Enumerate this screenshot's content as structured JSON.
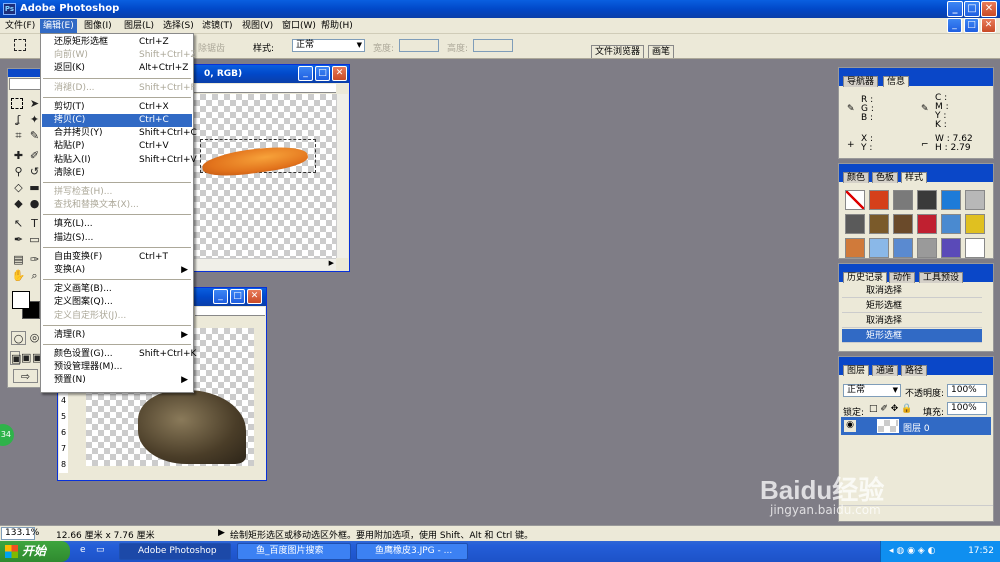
{
  "app": {
    "title": "Adobe Photoshop",
    "icon": "photoshop-icon"
  },
  "menubar": [
    "文件(F)",
    "编辑(E)",
    "图像(I)",
    "图层(L)",
    "选择(S)",
    "滤镜(T)",
    "视图(V)",
    "窗口(W)",
    "帮助(H)"
  ],
  "options": {
    "feather_label": "除锯齿",
    "style_label": "样式:",
    "style_value": "正常",
    "width_label": "宽度:",
    "height_label": "高度:",
    "tab_files": "文件浏览器",
    "tab_brushes": "画笔"
  },
  "doc1": {
    "title": "0, RGB)"
  },
  "edit_menu": [
    {
      "label": "还原矩形选框",
      "shortcut": "Ctrl+Z",
      "state": "normal"
    },
    {
      "label": "向前(W)",
      "shortcut": "Shift+Ctrl+Z",
      "state": "disabled"
    },
    {
      "label": "返回(K)",
      "shortcut": "Alt+Ctrl+Z",
      "state": "normal"
    },
    {
      "label": "消褪(D)...",
      "shortcut": "Shift+Ctrl+F",
      "state": "disabled"
    },
    {
      "label": "剪切(T)",
      "shortcut": "Ctrl+X",
      "state": "normal"
    },
    {
      "label": "拷贝(C)",
      "shortcut": "Ctrl+C",
      "state": "selected"
    },
    {
      "label": "合并拷贝(Y)",
      "shortcut": "Shift+Ctrl+C",
      "state": "normal"
    },
    {
      "label": "粘贴(P)",
      "shortcut": "Ctrl+V",
      "state": "normal"
    },
    {
      "label": "粘贴入(I)",
      "shortcut": "Shift+Ctrl+V",
      "state": "normal"
    },
    {
      "label": "清除(E)",
      "shortcut": "",
      "state": "normal"
    },
    {
      "label": "拼写检查(H)...",
      "shortcut": "",
      "state": "disabled"
    },
    {
      "label": "查找和替换文本(X)...",
      "shortcut": "",
      "state": "disabled"
    },
    {
      "label": "填充(L)...",
      "shortcut": "",
      "state": "normal"
    },
    {
      "label": "描边(S)...",
      "shortcut": "",
      "state": "normal"
    },
    {
      "label": "自由变换(F)",
      "shortcut": "Ctrl+T",
      "state": "normal"
    },
    {
      "label": "变换(A)",
      "shortcut": "",
      "state": "normal",
      "submenu": true
    },
    {
      "label": "定义画笔(B)...",
      "shortcut": "",
      "state": "normal"
    },
    {
      "label": "定义图案(Q)...",
      "shortcut": "",
      "state": "normal"
    },
    {
      "label": "定义自定形状(J)...",
      "shortcut": "",
      "state": "disabled"
    },
    {
      "label": "清理(R)",
      "shortcut": "",
      "state": "normal",
      "submenu": true
    },
    {
      "label": "颜色设置(G)...",
      "shortcut": "Shift+Ctrl+K",
      "state": "normal"
    },
    {
      "label": "预设管理器(M)...",
      "shortcut": "",
      "state": "normal"
    },
    {
      "label": "预置(N)",
      "shortcut": "",
      "state": "normal",
      "submenu": true
    }
  ],
  "navigator": {
    "tab1": "导航器",
    "tab2": "信息",
    "r": "R :",
    "g": "G :",
    "b": "B :",
    "c": "C :",
    "m": "M :",
    "y": "Y :",
    "k": "K :",
    "x": "X :",
    "yy": "Y :",
    "w": "W :",
    "w_val": "7.62",
    "h": "H :",
    "h_val": "2.79"
  },
  "swatches": {
    "tab1": "颜色",
    "tab2": "色板",
    "tab3": "样式",
    "colors": [
      "#ffffff",
      "#d5401a",
      "#7a7a7a",
      "#3a3a3a",
      "#1d7bd8",
      "#b8b8b8",
      "#5a5a5a",
      "#7a5a2a",
      "#6a4a2a",
      "#c02030",
      "#4a8ad0",
      "#e0c020",
      "#d07a3a",
      "#8ab8e8",
      "#5a8ad0",
      "#9a9a9a",
      "#5a4ab8",
      "#ffffff"
    ]
  },
  "history": {
    "tab1": "历史记录",
    "tab2": "动作",
    "tab3": "工具预设",
    "items": [
      "取消选择",
      "矩形选框",
      "取消选择",
      "矩形选框"
    ]
  },
  "layers": {
    "tab1": "图层",
    "tab2": "通道",
    "tab3": "路径",
    "mode": "正常",
    "opacity_label": "不透明度:",
    "opacity": "100%",
    "lock_label": "锁定:",
    "fill_label": "填充:",
    "fill": "100%",
    "layer_name": "图层 0"
  },
  "status": {
    "zoom": "133.1%",
    "size": "12.66 厘米 x 7.76 厘米",
    "hint": "绘制矩形选区或移动选区外框。要用附加选项，使用 Shift、Alt 和 Ctrl 键。"
  },
  "taskbar": {
    "start": "开始",
    "items": [
      "Adobe Photoshop",
      "鱼_百度图片搜索",
      "鱼鹰橡皮3.JPG - ..."
    ],
    "time": "17:52"
  },
  "watermark": {
    "brand": "Baidu经验",
    "url": "jingyan.baidu.com"
  },
  "left_badge": "34"
}
